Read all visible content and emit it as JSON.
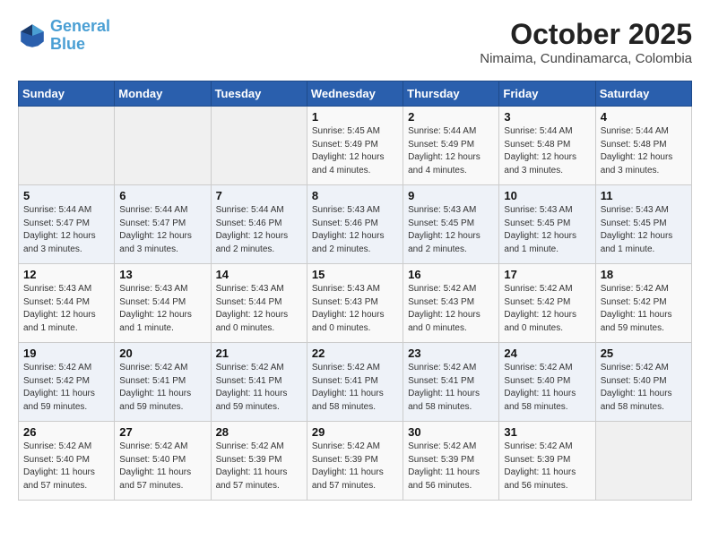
{
  "logo": {
    "line1": "General",
    "line2": "Blue"
  },
  "title": "October 2025",
  "subtitle": "Nimaima, Cundinamarca, Colombia",
  "days_of_week": [
    "Sunday",
    "Monday",
    "Tuesday",
    "Wednesday",
    "Thursday",
    "Friday",
    "Saturday"
  ],
  "weeks": [
    [
      {
        "day": "",
        "sunrise": "",
        "sunset": "",
        "daylight": ""
      },
      {
        "day": "",
        "sunrise": "",
        "sunset": "",
        "daylight": ""
      },
      {
        "day": "",
        "sunrise": "",
        "sunset": "",
        "daylight": ""
      },
      {
        "day": "1",
        "sunrise": "Sunrise: 5:45 AM",
        "sunset": "Sunset: 5:49 PM",
        "daylight": "Daylight: 12 hours and 4 minutes."
      },
      {
        "day": "2",
        "sunrise": "Sunrise: 5:44 AM",
        "sunset": "Sunset: 5:49 PM",
        "daylight": "Daylight: 12 hours and 4 minutes."
      },
      {
        "day": "3",
        "sunrise": "Sunrise: 5:44 AM",
        "sunset": "Sunset: 5:48 PM",
        "daylight": "Daylight: 12 hours and 3 minutes."
      },
      {
        "day": "4",
        "sunrise": "Sunrise: 5:44 AM",
        "sunset": "Sunset: 5:48 PM",
        "daylight": "Daylight: 12 hours and 3 minutes."
      }
    ],
    [
      {
        "day": "5",
        "sunrise": "Sunrise: 5:44 AM",
        "sunset": "Sunset: 5:47 PM",
        "daylight": "Daylight: 12 hours and 3 minutes."
      },
      {
        "day": "6",
        "sunrise": "Sunrise: 5:44 AM",
        "sunset": "Sunset: 5:47 PM",
        "daylight": "Daylight: 12 hours and 3 minutes."
      },
      {
        "day": "7",
        "sunrise": "Sunrise: 5:44 AM",
        "sunset": "Sunset: 5:46 PM",
        "daylight": "Daylight: 12 hours and 2 minutes."
      },
      {
        "day": "8",
        "sunrise": "Sunrise: 5:43 AM",
        "sunset": "Sunset: 5:46 PM",
        "daylight": "Daylight: 12 hours and 2 minutes."
      },
      {
        "day": "9",
        "sunrise": "Sunrise: 5:43 AM",
        "sunset": "Sunset: 5:45 PM",
        "daylight": "Daylight: 12 hours and 2 minutes."
      },
      {
        "day": "10",
        "sunrise": "Sunrise: 5:43 AM",
        "sunset": "Sunset: 5:45 PM",
        "daylight": "Daylight: 12 hours and 1 minute."
      },
      {
        "day": "11",
        "sunrise": "Sunrise: 5:43 AM",
        "sunset": "Sunset: 5:45 PM",
        "daylight": "Daylight: 12 hours and 1 minute."
      }
    ],
    [
      {
        "day": "12",
        "sunrise": "Sunrise: 5:43 AM",
        "sunset": "Sunset: 5:44 PM",
        "daylight": "Daylight: 12 hours and 1 minute."
      },
      {
        "day": "13",
        "sunrise": "Sunrise: 5:43 AM",
        "sunset": "Sunset: 5:44 PM",
        "daylight": "Daylight: 12 hours and 1 minute."
      },
      {
        "day": "14",
        "sunrise": "Sunrise: 5:43 AM",
        "sunset": "Sunset: 5:44 PM",
        "daylight": "Daylight: 12 hours and 0 minutes."
      },
      {
        "day": "15",
        "sunrise": "Sunrise: 5:43 AM",
        "sunset": "Sunset: 5:43 PM",
        "daylight": "Daylight: 12 hours and 0 minutes."
      },
      {
        "day": "16",
        "sunrise": "Sunrise: 5:42 AM",
        "sunset": "Sunset: 5:43 PM",
        "daylight": "Daylight: 12 hours and 0 minutes."
      },
      {
        "day": "17",
        "sunrise": "Sunrise: 5:42 AM",
        "sunset": "Sunset: 5:42 PM",
        "daylight": "Daylight: 12 hours and 0 minutes."
      },
      {
        "day": "18",
        "sunrise": "Sunrise: 5:42 AM",
        "sunset": "Sunset: 5:42 PM",
        "daylight": "Daylight: 11 hours and 59 minutes."
      }
    ],
    [
      {
        "day": "19",
        "sunrise": "Sunrise: 5:42 AM",
        "sunset": "Sunset: 5:42 PM",
        "daylight": "Daylight: 11 hours and 59 minutes."
      },
      {
        "day": "20",
        "sunrise": "Sunrise: 5:42 AM",
        "sunset": "Sunset: 5:41 PM",
        "daylight": "Daylight: 11 hours and 59 minutes."
      },
      {
        "day": "21",
        "sunrise": "Sunrise: 5:42 AM",
        "sunset": "Sunset: 5:41 PM",
        "daylight": "Daylight: 11 hours and 59 minutes."
      },
      {
        "day": "22",
        "sunrise": "Sunrise: 5:42 AM",
        "sunset": "Sunset: 5:41 PM",
        "daylight": "Daylight: 11 hours and 58 minutes."
      },
      {
        "day": "23",
        "sunrise": "Sunrise: 5:42 AM",
        "sunset": "Sunset: 5:41 PM",
        "daylight": "Daylight: 11 hours and 58 minutes."
      },
      {
        "day": "24",
        "sunrise": "Sunrise: 5:42 AM",
        "sunset": "Sunset: 5:40 PM",
        "daylight": "Daylight: 11 hours and 58 minutes."
      },
      {
        "day": "25",
        "sunrise": "Sunrise: 5:42 AM",
        "sunset": "Sunset: 5:40 PM",
        "daylight": "Daylight: 11 hours and 58 minutes."
      }
    ],
    [
      {
        "day": "26",
        "sunrise": "Sunrise: 5:42 AM",
        "sunset": "Sunset: 5:40 PM",
        "daylight": "Daylight: 11 hours and 57 minutes."
      },
      {
        "day": "27",
        "sunrise": "Sunrise: 5:42 AM",
        "sunset": "Sunset: 5:40 PM",
        "daylight": "Daylight: 11 hours and 57 minutes."
      },
      {
        "day": "28",
        "sunrise": "Sunrise: 5:42 AM",
        "sunset": "Sunset: 5:39 PM",
        "daylight": "Daylight: 11 hours and 57 minutes."
      },
      {
        "day": "29",
        "sunrise": "Sunrise: 5:42 AM",
        "sunset": "Sunset: 5:39 PM",
        "daylight": "Daylight: 11 hours and 57 minutes."
      },
      {
        "day": "30",
        "sunrise": "Sunrise: 5:42 AM",
        "sunset": "Sunset: 5:39 PM",
        "daylight": "Daylight: 11 hours and 56 minutes."
      },
      {
        "day": "31",
        "sunrise": "Sunrise: 5:42 AM",
        "sunset": "Sunset: 5:39 PM",
        "daylight": "Daylight: 11 hours and 56 minutes."
      },
      {
        "day": "",
        "sunrise": "",
        "sunset": "",
        "daylight": ""
      }
    ]
  ]
}
